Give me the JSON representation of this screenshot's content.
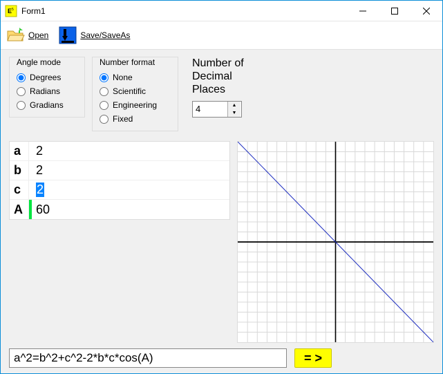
{
  "window": {
    "title": "Form1"
  },
  "toolbar": {
    "open_label": "Open",
    "save_label": "Save/SaveAs"
  },
  "angle_mode": {
    "title": "Angle mode",
    "options": [
      "Degrees",
      "Radians",
      "Gradians"
    ],
    "selected": "Degrees"
  },
  "number_format": {
    "title": "Number format",
    "options": [
      "None",
      "Scientific",
      "Engineering",
      "Fixed"
    ],
    "selected": "None"
  },
  "decimal_places": {
    "label_line1": "Number of",
    "label_line2": "Decimal",
    "label_line3": "Places",
    "value": "4"
  },
  "variables": [
    {
      "name": "a",
      "value": "2",
      "selected": false,
      "marker": ""
    },
    {
      "name": "b",
      "value": "2",
      "selected": false,
      "marker": ""
    },
    {
      "name": "c",
      "value": "2",
      "selected": true,
      "marker": ""
    },
    {
      "name": "A",
      "value": "60",
      "selected": false,
      "marker": "green"
    }
  ],
  "expression": {
    "value": "a^2=b^2+c^2-2*b*c*cos(A)"
  },
  "go_button": {
    "label": "= >"
  },
  "chart_data": {
    "type": "line",
    "title": "",
    "xlabel": "",
    "ylabel": "",
    "xlim": [
      -10,
      10
    ],
    "ylim": [
      -10,
      10
    ],
    "grid": true,
    "series": [
      {
        "name": "line",
        "x": [
          -10,
          10
        ],
        "y": [
          10,
          -10
        ]
      }
    ]
  }
}
